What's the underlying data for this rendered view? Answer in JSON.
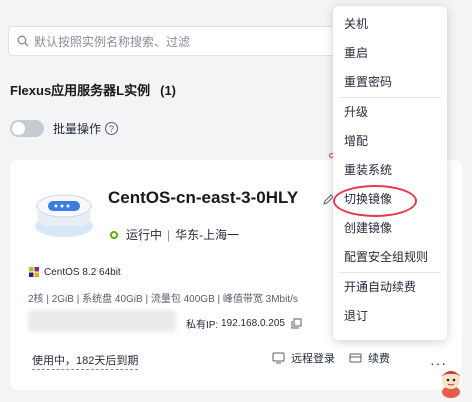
{
  "search": {
    "placeholder": "默认按照实例名称搜索、过滤"
  },
  "section": {
    "title": "Flexus应用服务器L实例",
    "count": "(1)"
  },
  "batch": {
    "label": "批量操作",
    "help": "?"
  },
  "card": {
    "name": "CentOS-cn-east-3-0HLY",
    "status": "运行中",
    "region": "华东-上海一",
    "os": "CentOS 8.2 64bit",
    "spec": "2核 | 2GiB | 系统盘 40GiB | 流量包 400GB | 峰值带宽 3Mbit/s",
    "ip_label": "私有IP:",
    "ip_value": "192.168.0.205",
    "expire": "使用中，182天后到期",
    "remote_login": "远程登录",
    "renew": "续费",
    "more": "···"
  },
  "menu": {
    "groups": [
      [
        "关机",
        "重启",
        "重置密码"
      ],
      [
        "升级",
        "增配",
        "重装系统",
        "切换镜像",
        "创建镜像",
        "配置安全组规则"
      ],
      [
        "开通自动续费",
        "退订"
      ]
    ],
    "highlighted": "切换镜像"
  },
  "colors": {
    "status_green": "#5cb300",
    "highlight_red": "#e6394b"
  }
}
